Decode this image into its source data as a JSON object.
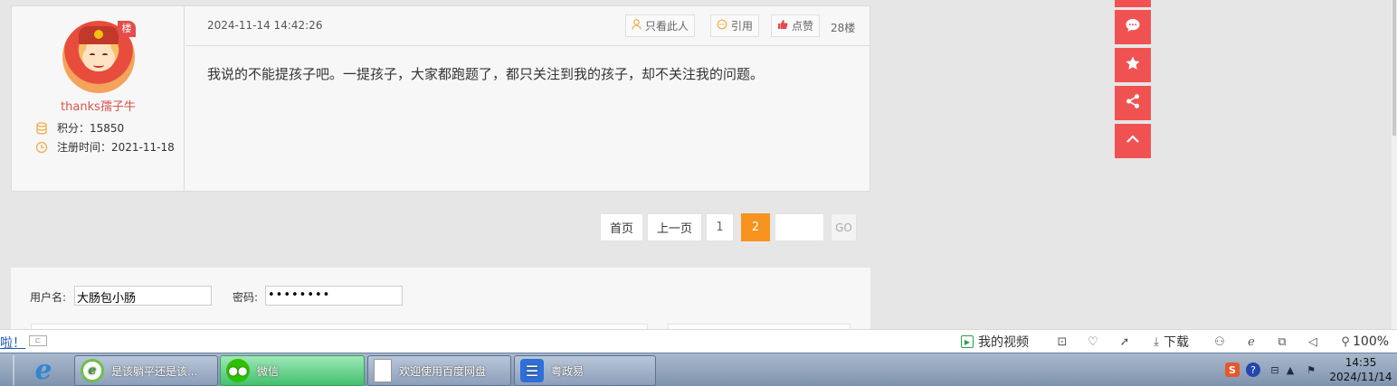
{
  "post": {
    "author": {
      "username": "thanks孺子牛",
      "floor_badge": "楼",
      "points_label": "积分：",
      "points": "15850",
      "register_label": "注册时间：",
      "register_date": "2021-11-18"
    },
    "timestamp": "2024-11-14 14:42:26",
    "only_author_label": "只看此人",
    "quote_label": "引用",
    "like_label": "点赞",
    "floor": "28楼",
    "content": "我说的不能提孩子吧。一提孩子，大家都跑题了，都只关注到我的孩子，却不关注我的问题。"
  },
  "pagination": {
    "first": "首页",
    "prev": "上一页",
    "pages": [
      "1",
      "2"
    ],
    "current": "2",
    "go": "GO",
    "input_value": ""
  },
  "login": {
    "username_label": "用户名:",
    "username_value": "大肠包小肠",
    "password_label": "密码:",
    "password_value": "••••••••"
  },
  "floating_actions": [
    {
      "icon": "comment-icon"
    },
    {
      "icon": "star-icon"
    },
    {
      "icon": "share-icon"
    },
    {
      "icon": "chevron-up-icon"
    }
  ],
  "status_bar": {
    "left_text": "啦！",
    "my_video": "我的视频",
    "download": "下载",
    "zoom": "100%"
  },
  "taskbar": {
    "tasks": [
      {
        "label": "是该躺平还是该...",
        "icon": "ie-browser-icon"
      },
      {
        "label": "微信",
        "icon": "wechat-icon"
      },
      {
        "label": "欢迎使用百度网盘",
        "icon": "document-icon"
      },
      {
        "label": "粤政易",
        "icon": "yuezhengyi-icon"
      }
    ],
    "clock_time": "14:35",
    "clock_date": "2024/11/14"
  },
  "colors": {
    "accent_orange": "#f7931e",
    "float_red": "#f05252",
    "username_red": "#d9534f"
  }
}
